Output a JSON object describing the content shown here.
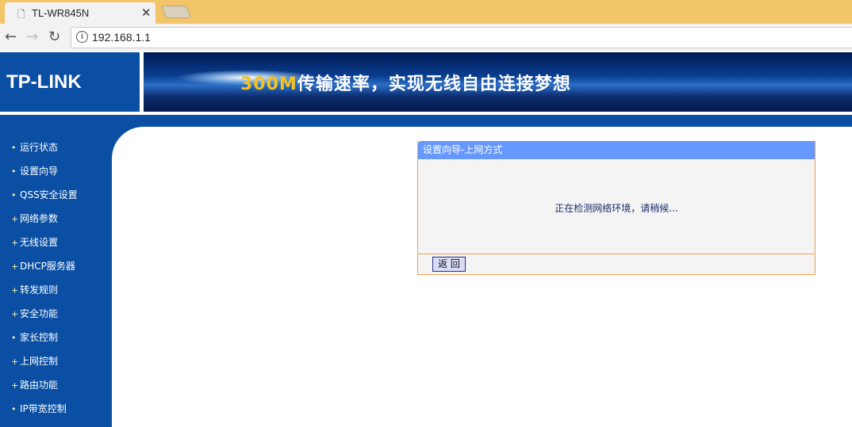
{
  "browser": {
    "tab_title": "TL-WR845N",
    "url": "192.168.1.1"
  },
  "header": {
    "logo": "TP-LINK",
    "slogan_highlight": "300M",
    "slogan_rest": "传输速率，实现无线自由连接梦想"
  },
  "sidebar": {
    "items": [
      {
        "label": "运行状态",
        "bullet": "•"
      },
      {
        "label": "设置向导",
        "bullet": "•"
      },
      {
        "label": "QSS安全设置",
        "bullet": "•"
      },
      {
        "label": "网络参数",
        "bullet": "+"
      },
      {
        "label": "无线设置",
        "bullet": "+"
      },
      {
        "label": "DHCP服务器",
        "bullet": "+"
      },
      {
        "label": "转发规则",
        "bullet": "+"
      },
      {
        "label": "安全功能",
        "bullet": "+"
      },
      {
        "label": "家长控制",
        "bullet": "•"
      },
      {
        "label": "上网控制",
        "bullet": "+"
      },
      {
        "label": "路由功能",
        "bullet": "+"
      },
      {
        "label": "IP带宽控制",
        "bullet": "•"
      }
    ]
  },
  "panel": {
    "title": "设置向导-上网方式",
    "message": "正在检测网络环境，请稍候...",
    "back_label": "返 回"
  }
}
